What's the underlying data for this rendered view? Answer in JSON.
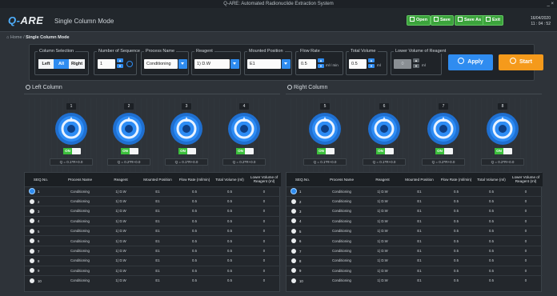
{
  "window": {
    "title": "Q-ARE: Automated Radionuclide Extraction System",
    "controls": "_ ×"
  },
  "header": {
    "logo_q": "Q-",
    "logo_rest": "ARE",
    "mode": "Single Column Mode",
    "buttons": {
      "open": "Open",
      "save": "Save",
      "save_as": "Save As",
      "exit": "Exit"
    },
    "date": "16/04/2020",
    "time": "11 : 04 : 52"
  },
  "breadcrumb": {
    "home": "Home",
    "sep": "/",
    "current": "Single Column Mode"
  },
  "toolbar": {
    "column_selection": {
      "label": "Column Selection",
      "options": [
        "Left",
        "All",
        "Right"
      ],
      "selected": "All"
    },
    "sequence": {
      "label": "Number of Sequence",
      "value": "1"
    },
    "process": {
      "label": "Process Name",
      "value": "Conditioning"
    },
    "reagent": {
      "label": "Reagent",
      "value": "1) D.W"
    },
    "mounted": {
      "label": "Mounted Position",
      "value": "E1"
    },
    "flow": {
      "label": "Flow Rate",
      "value": "0.5",
      "unit": "ml / min"
    },
    "total": {
      "label": "Total Volume",
      "value": "0.5",
      "unit": "ml"
    },
    "lower": {
      "label": "Lower Volume of Reagent",
      "value": "0",
      "unit": "ml"
    },
    "apply": "Apply",
    "start": "Start"
  },
  "left": {
    "title": "Left Column",
    "valves": [
      {
        "num": "1",
        "q": "Q = 0.1*R+0.0"
      },
      {
        "num": "2",
        "q": "Q = 0.2*R+0.0"
      },
      {
        "num": "3",
        "q": "Q = 0.1*R+0.0"
      },
      {
        "num": "4",
        "q": "Q = 0.2*R+0.0"
      }
    ]
  },
  "right": {
    "title": "Right Column",
    "valves": [
      {
        "num": "5",
        "q": "Q = 0.1*R+0.0"
      },
      {
        "num": "6",
        "q": "Q = 0.1*R+0.0"
      },
      {
        "num": "7",
        "q": "Q = 0.2*R+0.0"
      },
      {
        "num": "8",
        "q": "Q = 0.2*R+0.0"
      }
    ]
  },
  "on_label": "ON",
  "table": {
    "headers": [
      "SEQ.No.",
      "Process Name",
      "Reagent",
      "Mounted Position",
      "Flow Rate (ml/min)",
      "Total Volume (ml)",
      "Lower Volume of Reagent (ml)"
    ],
    "left_rows": [
      [
        "1",
        "Conditioning",
        "1) D.W",
        "E1",
        "0.5",
        "0.5",
        "0"
      ],
      [
        "2",
        "Conditioning",
        "1) D.W",
        "E1",
        "0.5",
        "0.5",
        "0"
      ],
      [
        "3",
        "Conditioning",
        "1) D.W",
        "E1",
        "0.5",
        "0.5",
        "0"
      ],
      [
        "4",
        "Conditioning",
        "1) D.W",
        "E1",
        "0.5",
        "0.5",
        "0"
      ],
      [
        "5",
        "Conditioning",
        "1) D.W",
        "E1",
        "0.5",
        "0.5",
        "0"
      ],
      [
        "6",
        "Conditioning",
        "1) D.W",
        "E1",
        "0.5",
        "0.5",
        "0"
      ],
      [
        "7",
        "Conditioning",
        "1) D.W",
        "E1",
        "0.5",
        "0.5",
        "0"
      ],
      [
        "8",
        "Conditioning",
        "1) D.W",
        "E1",
        "0.5",
        "0.5",
        "0"
      ],
      [
        "9",
        "Conditioning",
        "1) D.W",
        "E1",
        "0.5",
        "0.5",
        "0"
      ],
      [
        "10",
        "Conditioning",
        "1) D.W",
        "E1",
        "0.5",
        "0.5",
        "0"
      ]
    ],
    "right_rows": [
      [
        "1",
        "Conditioning",
        "1) D.W",
        "E1",
        "0.5",
        "0.5",
        "0"
      ],
      [
        "2",
        "Conditioning",
        "1) D.W",
        "E1",
        "0.5",
        "0.5",
        "0"
      ],
      [
        "3",
        "Conditioning",
        "1) D.W",
        "E1",
        "0.5",
        "0.5",
        "0"
      ],
      [
        "4",
        "Conditioning",
        "1) D.W",
        "E1",
        "0.5",
        "0.5",
        "0"
      ],
      [
        "5",
        "Conditioning",
        "1) D.W",
        "E1",
        "0.5",
        "0.5",
        "0"
      ],
      [
        "6",
        "Conditioning",
        "1) D.W",
        "E1",
        "0.5",
        "0.5",
        "0"
      ],
      [
        "7",
        "Conditioning",
        "1) D.W",
        "E1",
        "0.5",
        "0.5",
        "0"
      ],
      [
        "8",
        "Conditioning",
        "1) D.W",
        "E1",
        "0.5",
        "0.5",
        "0"
      ],
      [
        "9",
        "Conditioning",
        "1) D.W",
        "E1",
        "0.5",
        "0.5",
        "0"
      ],
      [
        "10",
        "Conditioning",
        "1) D.W",
        "E1",
        "0.5",
        "0.5",
        "0"
      ]
    ]
  },
  "colors": {
    "accent": "#2f8cf0",
    "start": "#f59a1b",
    "header_button": "#3ca43c",
    "valve": "#2d8cf5",
    "on": "#3cbf3c"
  }
}
